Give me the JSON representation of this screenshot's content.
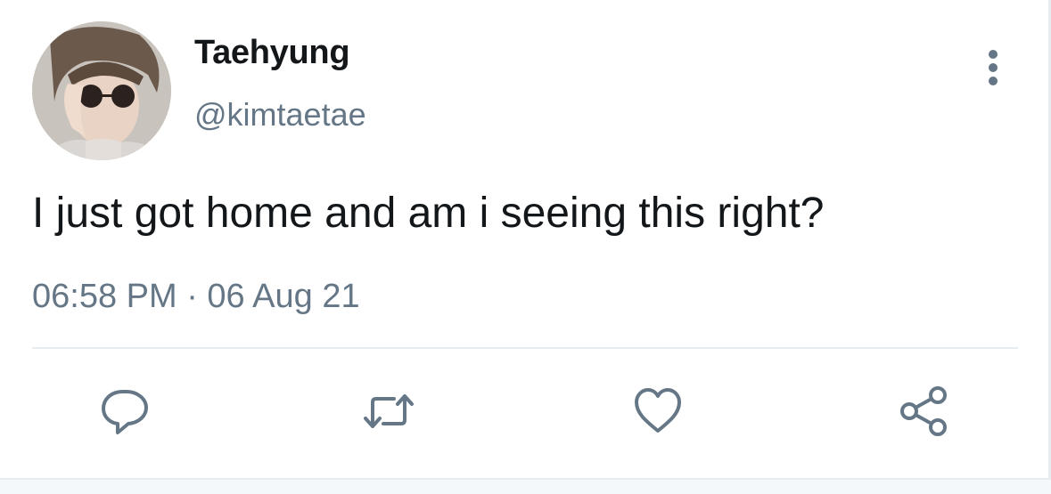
{
  "user": {
    "display_name": "Taehyung",
    "handle": "@kimtaetae"
  },
  "tweet": {
    "text": "I just got home and am i seeing this right?",
    "timestamp": "06:58 PM · 06 Aug 21"
  },
  "actions": {
    "reply_icon": "reply-icon",
    "retweet_icon": "retweet-icon",
    "like_icon": "heart-icon",
    "share_icon": "share-icon"
  },
  "colors": {
    "text_primary": "#14171a",
    "text_secondary": "#657786",
    "divider": "#e6ecf0"
  }
}
